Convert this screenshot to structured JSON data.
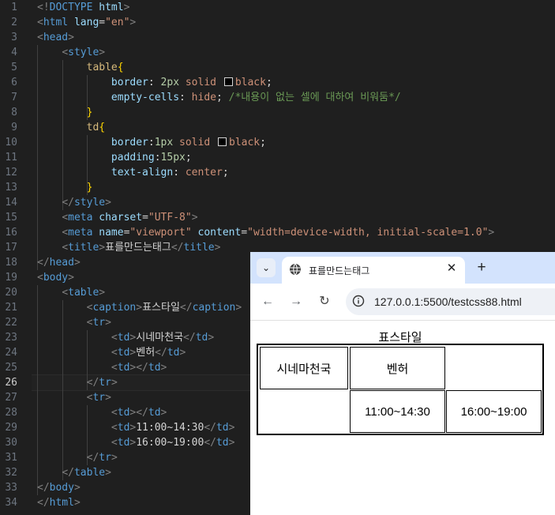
{
  "editor": {
    "lines": [
      {
        "n": "1",
        "segs": [
          [
            "br",
            "<!"
          ],
          [
            "tag",
            "DOCTYPE"
          ],
          [
            "txt",
            " "
          ],
          [
            "attr",
            "html"
          ],
          [
            "br",
            ">"
          ]
        ]
      },
      {
        "n": "2",
        "segs": [
          [
            "br",
            "<"
          ],
          [
            "tag",
            "html"
          ],
          [
            "txt",
            " "
          ],
          [
            "attr",
            "lang"
          ],
          [
            "txt",
            "="
          ],
          [
            "str",
            "\"en\""
          ],
          [
            "br",
            ">"
          ]
        ]
      },
      {
        "n": "3",
        "segs": [
          [
            "br",
            "<"
          ],
          [
            "tag",
            "head"
          ],
          [
            "br",
            ">"
          ]
        ]
      },
      {
        "n": "4",
        "segs": [
          [
            "txt",
            "    "
          ],
          [
            "br",
            "<"
          ],
          [
            "tag",
            "style"
          ],
          [
            "br",
            ">"
          ]
        ]
      },
      {
        "n": "5",
        "segs": [
          [
            "txt",
            "        "
          ],
          [
            "sel",
            "table"
          ],
          [
            "brace",
            "{"
          ]
        ]
      },
      {
        "n": "6",
        "segs": [
          [
            "txt",
            "            "
          ],
          [
            "prop",
            "border"
          ],
          [
            "txt",
            ": "
          ],
          [
            "num",
            "2px"
          ],
          [
            "txt",
            " "
          ],
          [
            "val",
            "solid"
          ],
          [
            "txt",
            " "
          ],
          [
            "swatch",
            ""
          ],
          [
            "val",
            "black"
          ],
          [
            "txt",
            ";"
          ]
        ]
      },
      {
        "n": "7",
        "segs": [
          [
            "txt",
            "            "
          ],
          [
            "prop",
            "empty-cells"
          ],
          [
            "txt",
            ": "
          ],
          [
            "val",
            "hide"
          ],
          [
            "txt",
            "; "
          ],
          [
            "com",
            "/*내용이 없는 셀에 대하여 비워둠*/"
          ]
        ]
      },
      {
        "n": "8",
        "segs": [
          [
            "txt",
            "        "
          ],
          [
            "brace",
            "}"
          ]
        ]
      },
      {
        "n": "9",
        "segs": [
          [
            "txt",
            "        "
          ],
          [
            "sel",
            "td"
          ],
          [
            "brace",
            "{"
          ]
        ]
      },
      {
        "n": "10",
        "segs": [
          [
            "txt",
            "            "
          ],
          [
            "prop",
            "border"
          ],
          [
            "txt",
            ":"
          ],
          [
            "num",
            "1px"
          ],
          [
            "txt",
            " "
          ],
          [
            "val",
            "solid"
          ],
          [
            "txt",
            " "
          ],
          [
            "swatch",
            ""
          ],
          [
            "val",
            "black"
          ],
          [
            "txt",
            ";"
          ]
        ]
      },
      {
        "n": "11",
        "segs": [
          [
            "txt",
            "            "
          ],
          [
            "prop",
            "padding"
          ],
          [
            "txt",
            ":"
          ],
          [
            "num",
            "15px"
          ],
          [
            "txt",
            ";"
          ]
        ]
      },
      {
        "n": "12",
        "segs": [
          [
            "txt",
            "            "
          ],
          [
            "prop",
            "text-align"
          ],
          [
            "txt",
            ": "
          ],
          [
            "val",
            "center"
          ],
          [
            "txt",
            ";"
          ]
        ]
      },
      {
        "n": "13",
        "segs": [
          [
            "txt",
            "        "
          ],
          [
            "brace",
            "}"
          ]
        ]
      },
      {
        "n": "14",
        "segs": [
          [
            "txt",
            "    "
          ],
          [
            "br",
            "</"
          ],
          [
            "tag",
            "style"
          ],
          [
            "br",
            ">"
          ]
        ]
      },
      {
        "n": "15",
        "segs": [
          [
            "txt",
            "    "
          ],
          [
            "br",
            "<"
          ],
          [
            "tag",
            "meta"
          ],
          [
            "txt",
            " "
          ],
          [
            "attr",
            "charset"
          ],
          [
            "txt",
            "="
          ],
          [
            "str",
            "\"UTF-8\""
          ],
          [
            "br",
            ">"
          ]
        ]
      },
      {
        "n": "16",
        "segs": [
          [
            "txt",
            "    "
          ],
          [
            "br",
            "<"
          ],
          [
            "tag",
            "meta"
          ],
          [
            "txt",
            " "
          ],
          [
            "attr",
            "name"
          ],
          [
            "txt",
            "="
          ],
          [
            "str",
            "\"viewport\""
          ],
          [
            "txt",
            " "
          ],
          [
            "attr",
            "content"
          ],
          [
            "txt",
            "="
          ],
          [
            "str",
            "\"width=device-width, initial-scale=1.0\""
          ],
          [
            "br",
            ">"
          ]
        ]
      },
      {
        "n": "17",
        "segs": [
          [
            "txt",
            "    "
          ],
          [
            "br",
            "<"
          ],
          [
            "tag",
            "title"
          ],
          [
            "br",
            ">"
          ],
          [
            "txt",
            "표를만드는태그"
          ],
          [
            "br",
            "</"
          ],
          [
            "tag",
            "title"
          ],
          [
            "br",
            ">"
          ]
        ]
      },
      {
        "n": "18",
        "segs": [
          [
            "br",
            "</"
          ],
          [
            "tag",
            "head"
          ],
          [
            "br",
            ">"
          ]
        ]
      },
      {
        "n": "19",
        "segs": [
          [
            "br",
            "<"
          ],
          [
            "tag",
            "body"
          ],
          [
            "br",
            ">"
          ]
        ]
      },
      {
        "n": "20",
        "segs": [
          [
            "txt",
            "    "
          ],
          [
            "br",
            "<"
          ],
          [
            "tag",
            "table"
          ],
          [
            "br",
            ">"
          ]
        ]
      },
      {
        "n": "21",
        "segs": [
          [
            "txt",
            "        "
          ],
          [
            "br",
            "<"
          ],
          [
            "tag",
            "caption"
          ],
          [
            "br",
            ">"
          ],
          [
            "txt",
            "표스타일"
          ],
          [
            "br",
            "</"
          ],
          [
            "tag",
            "caption"
          ],
          [
            "br",
            ">"
          ]
        ]
      },
      {
        "n": "22",
        "segs": [
          [
            "txt",
            "        "
          ],
          [
            "br",
            "<"
          ],
          [
            "tag",
            "tr"
          ],
          [
            "br",
            ">"
          ]
        ]
      },
      {
        "n": "23",
        "segs": [
          [
            "txt",
            "            "
          ],
          [
            "br",
            "<"
          ],
          [
            "tag",
            "td"
          ],
          [
            "br",
            ">"
          ],
          [
            "txt",
            "시네마천국"
          ],
          [
            "br",
            "</"
          ],
          [
            "tag",
            "td"
          ],
          [
            "br",
            ">"
          ]
        ]
      },
      {
        "n": "24",
        "segs": [
          [
            "txt",
            "            "
          ],
          [
            "br",
            "<"
          ],
          [
            "tag",
            "td"
          ],
          [
            "br",
            ">"
          ],
          [
            "txt",
            "벤허"
          ],
          [
            "br",
            "</"
          ],
          [
            "tag",
            "td"
          ],
          [
            "br",
            ">"
          ]
        ]
      },
      {
        "n": "25",
        "segs": [
          [
            "txt",
            "            "
          ],
          [
            "br",
            "<"
          ],
          [
            "tag",
            "td"
          ],
          [
            "br",
            "></"
          ],
          [
            "tag",
            "td"
          ],
          [
            "br",
            ">"
          ]
        ]
      },
      {
        "n": "26",
        "segs": [
          [
            "txt",
            "        "
          ],
          [
            "br",
            "</"
          ],
          [
            "tag",
            "tr"
          ],
          [
            "br",
            ">"
          ]
        ]
      },
      {
        "n": "27",
        "segs": [
          [
            "txt",
            "        "
          ],
          [
            "br",
            "<"
          ],
          [
            "tag",
            "tr"
          ],
          [
            "br",
            ">"
          ]
        ]
      },
      {
        "n": "28",
        "segs": [
          [
            "txt",
            "            "
          ],
          [
            "br",
            "<"
          ],
          [
            "tag",
            "td"
          ],
          [
            "br",
            "></"
          ],
          [
            "tag",
            "td"
          ],
          [
            "br",
            ">"
          ]
        ]
      },
      {
        "n": "29",
        "segs": [
          [
            "txt",
            "            "
          ],
          [
            "br",
            "<"
          ],
          [
            "tag",
            "td"
          ],
          [
            "br",
            ">"
          ],
          [
            "txt",
            "11:00~14:30"
          ],
          [
            "br",
            "</"
          ],
          [
            "tag",
            "td"
          ],
          [
            "br",
            ">"
          ]
        ]
      },
      {
        "n": "30",
        "segs": [
          [
            "txt",
            "            "
          ],
          [
            "br",
            "<"
          ],
          [
            "tag",
            "td"
          ],
          [
            "br",
            ">"
          ],
          [
            "txt",
            "16:00~19:00"
          ],
          [
            "br",
            "</"
          ],
          [
            "tag",
            "td"
          ],
          [
            "br",
            ">"
          ]
        ]
      },
      {
        "n": "31",
        "segs": [
          [
            "txt",
            "        "
          ],
          [
            "br",
            "</"
          ],
          [
            "tag",
            "tr"
          ],
          [
            "br",
            ">"
          ]
        ]
      },
      {
        "n": "32",
        "segs": [
          [
            "txt",
            "    "
          ],
          [
            "br",
            "</"
          ],
          [
            "tag",
            "table"
          ],
          [
            "br",
            ">"
          ]
        ]
      },
      {
        "n": "33",
        "segs": [
          [
            "br",
            "</"
          ],
          [
            "tag",
            "body"
          ],
          [
            "br",
            ">"
          ]
        ]
      },
      {
        "n": "34",
        "segs": [
          [
            "br",
            "</"
          ],
          [
            "tag",
            "html"
          ],
          [
            "br",
            ">"
          ]
        ]
      }
    ],
    "current_line": "26"
  },
  "browser": {
    "tab_title": "표를만드는태그",
    "tab_close": "✕",
    "new_tab": "+",
    "tab_list_icon": "⌄",
    "back": "←",
    "forward": "→",
    "reload": "↻",
    "url": "127.0.0.1:5500/testcss88.html",
    "page": {
      "caption": "표스타일",
      "rows": [
        [
          "시네마천국",
          "벤허",
          ""
        ],
        [
          "",
          "11:00~14:30",
          "16:00~19:00"
        ]
      ]
    }
  }
}
